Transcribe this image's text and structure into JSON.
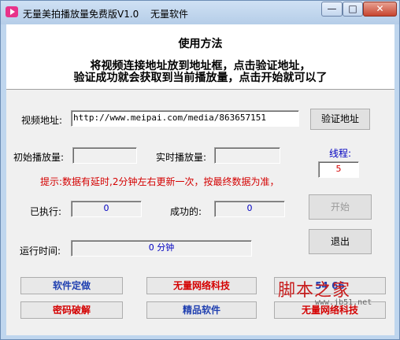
{
  "window": {
    "title": "无量美拍播放量免费版V1.0",
    "vendor": "无量软件"
  },
  "instructions": {
    "heading": "使用方法",
    "line1": "将视频连接地址放到地址框，点击验证地址，",
    "line2": "验证成功就会获取到当前播放量，点击开始就可以了"
  },
  "form": {
    "url_label": "视频地址:",
    "url_value": "http://www.meipai.com/media/863657151",
    "verify_label": "验证地址",
    "initial_label": "初始播放量:",
    "initial_value": "",
    "realtime_label": "实时播放量:",
    "realtime_value": "",
    "thread_label": "线程:",
    "thread_value": "5",
    "hint": "提示:数据有延时,2分钟左右更新一次，按最终数据为准，",
    "executed_label": "已执行:",
    "executed_value": "0",
    "success_label": "成功的:",
    "success_value": "0",
    "start_label": "开始",
    "exit_label": "退出",
    "runtime_label": "运行时间:",
    "runtime_value": "0 分钟"
  },
  "links": {
    "custom": "软件定做",
    "tech1": "无量网络科技",
    "crack": "密码破解",
    "boutique": "精品软件",
    "tech2": "无量网络科技",
    "partial": "54  66"
  },
  "watermark": {
    "text": "脚本之家",
    "url": "www.jb51.net"
  },
  "colors": {
    "accent_blue": "#1f3fb0",
    "accent_red": "#d40000"
  }
}
